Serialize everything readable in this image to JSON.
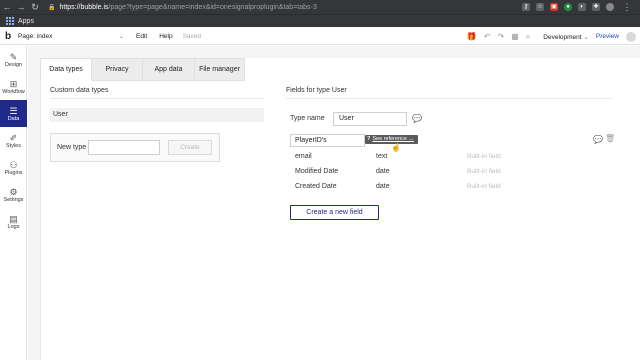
{
  "browser": {
    "url_host": "https://bubble.is",
    "url_path": "/page?type=page&name=index&id=onesignalproplugin&tab=tabs-3",
    "bookmark_label": "Apps"
  },
  "editor": {
    "page_select": "Page: index",
    "menu_edit": "Edit",
    "menu_help": "Help",
    "saved_status": "Saved",
    "dev_select": "Development",
    "preview_label": "Preview"
  },
  "sidebar": {
    "items": [
      {
        "label": "Design",
        "icon": "design-icon"
      },
      {
        "label": "Workflow",
        "icon": "workflow-icon"
      },
      {
        "label": "Data",
        "icon": "database-icon",
        "active": true
      },
      {
        "label": "Styles",
        "icon": "brush-icon"
      },
      {
        "label": "Plugins",
        "icon": "plugin-icon"
      },
      {
        "label": "Settings",
        "icon": "gear-icon"
      },
      {
        "label": "Logs",
        "icon": "document-icon"
      }
    ]
  },
  "tabs": [
    "Data types",
    "Privacy",
    "App data",
    "File manager"
  ],
  "left_panel": {
    "title": "Custom data types",
    "types": [
      "User"
    ],
    "new_type_label": "New type",
    "new_type_value": "",
    "create_label": "Create"
  },
  "right_panel": {
    "title": "Fields for type User",
    "type_name_label": "Type name",
    "type_name_value": "User",
    "new_field_value": "PlayerID's",
    "tooltip_q": "?",
    "tooltip_link": "See reference →",
    "fields": [
      {
        "name": "email",
        "type": "text",
        "note": "Built-in field"
      },
      {
        "name": "Modified Date",
        "type": "date",
        "note": "Built-in field"
      },
      {
        "name": "Created Date",
        "type": "date",
        "note": "Built-in field"
      }
    ],
    "create_field_label": "Create a new field"
  }
}
